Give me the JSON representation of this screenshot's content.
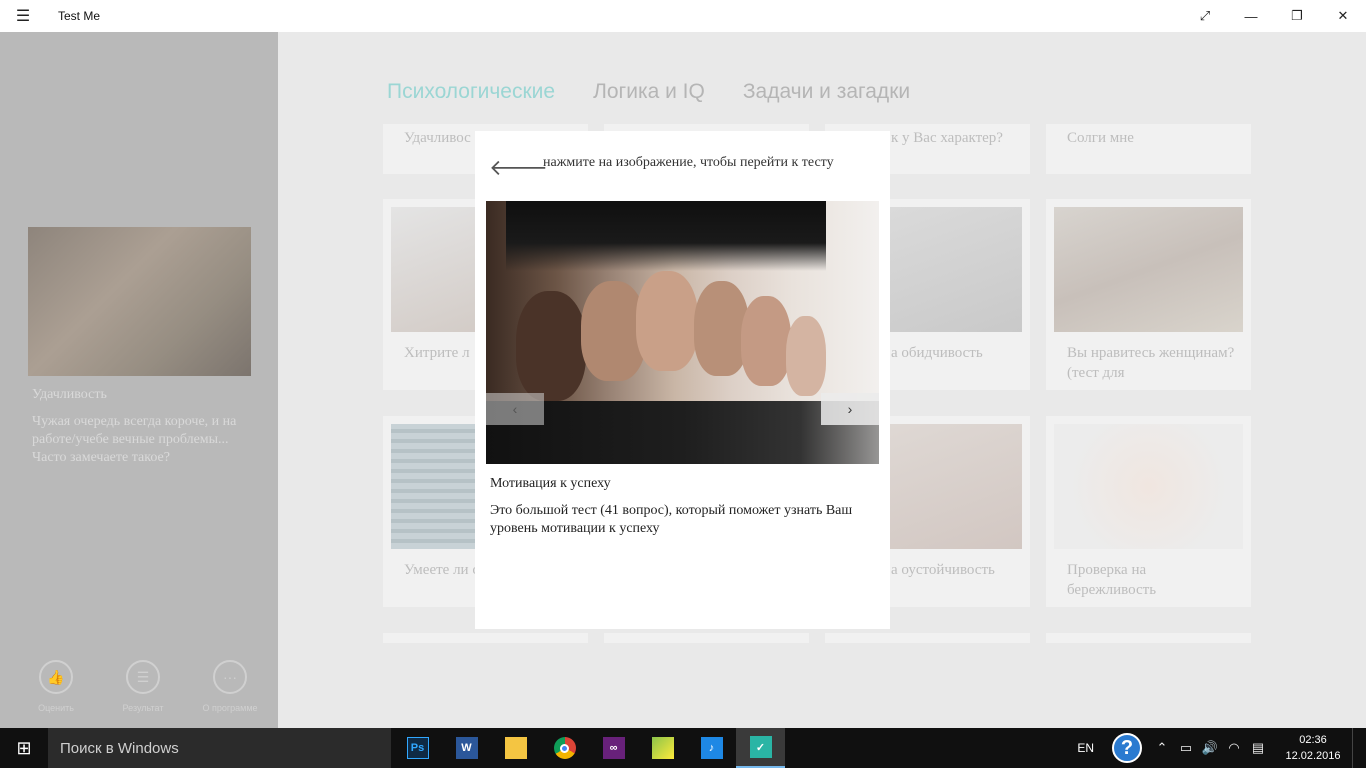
{
  "window": {
    "title": "Test Me",
    "menu_icon": "hamburger-icon",
    "controls": [
      "fullscreen-icon",
      "minimize-icon",
      "restore-icon",
      "close-icon"
    ]
  },
  "sidebar": {
    "featured": {
      "title": "Удачливость",
      "description": "Чужая очередь всегда короче, и на работе/учебе вечные проблемы... Часто замечаете такое?"
    },
    "actions": [
      {
        "label": "Оценить",
        "icon": "thumbs-up-icon"
      },
      {
        "label": "Результат",
        "icon": "list-icon"
      },
      {
        "label": "О программе",
        "icon": "more-icon"
      }
    ]
  },
  "tabs": [
    {
      "label": "Психологические",
      "active": true
    },
    {
      "label": "Логика и IQ",
      "active": false
    },
    {
      "label": "Задачи и загадки",
      "active": false
    }
  ],
  "cards": {
    "row1": [
      "Удачливос",
      "к у Вас характер?",
      "Солги мне"
    ],
    "row2": [
      "Хитрите л",
      "а обидчивость",
      "Вы нравитесь женщинам? (тест для"
    ],
    "row3": [
      "Умеете ли справлять",
      "а оустойчивость",
      "Проверка на бережливость"
    ]
  },
  "modal": {
    "hint": "нажмите на изображение, чтобы перейти к тесту",
    "test_title": "Мотивация к успеху",
    "test_description": "Это большой тест (41 вопрос), который поможет узнать Ваш уровень мотивации к успеху",
    "prev_icon": "chevron-left-icon",
    "next_icon": "chevron-right-icon"
  },
  "taskbar": {
    "search_placeholder": "Поиск в Windows",
    "apps": [
      "Ps",
      "W",
      "folder",
      "chrome",
      "vs",
      "maps",
      "music",
      "testme"
    ],
    "language": "EN",
    "time": "02:36",
    "date": "12.02.2016"
  },
  "colors": {
    "accent_tab": "#9bd6d4",
    "sidebar_bg": "#b9b9b9",
    "taskbar_bg": "#101010"
  }
}
